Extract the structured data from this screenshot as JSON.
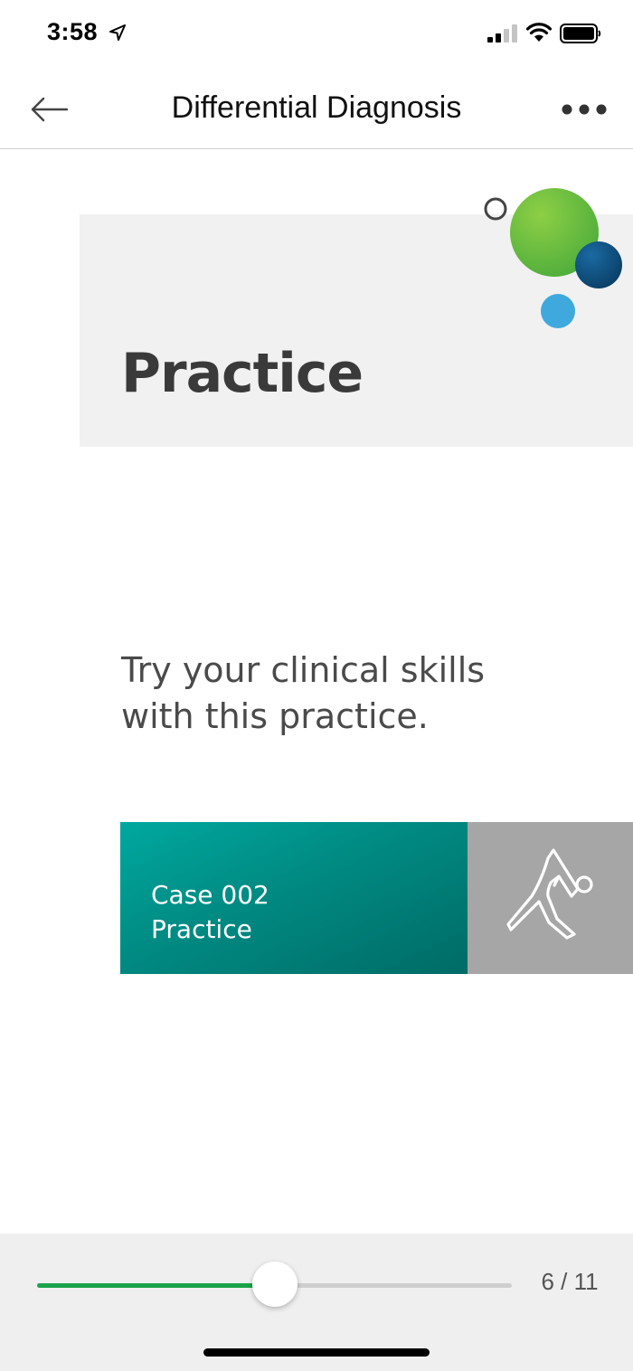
{
  "status_bar": {
    "time": "3:58",
    "icons": [
      "location-arrow-icon",
      "cellular-signal-icon",
      "wifi-icon",
      "battery-icon"
    ]
  },
  "nav": {
    "title": "Differential Diagnosis",
    "back_icon": "back-arrow-icon",
    "more_icon": "more-options-icon"
  },
  "slide": {
    "heading": "Practice",
    "body": "Try your clinical skills\nwith this practice.",
    "case_card": {
      "label": "Case 002\nPractice",
      "icon": "exercise-figure-icon"
    },
    "decor_colors": {
      "green": "#7ac143",
      "navy": "#0d4f7d",
      "light_blue": "#3fa9de",
      "outline": "#444444"
    }
  },
  "progress": {
    "current": 6,
    "total": 11,
    "label": "6 / 11",
    "fill_fraction": 0.5,
    "accent_color": "#1aa34a"
  }
}
